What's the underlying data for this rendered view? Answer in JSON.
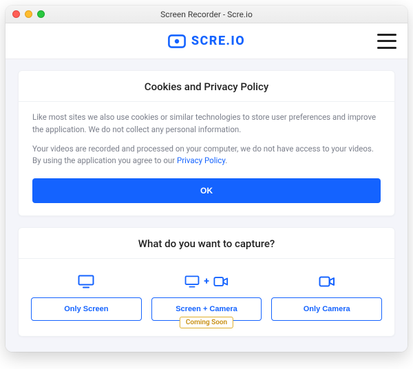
{
  "window": {
    "title": "Screen Recorder - Scre.io"
  },
  "brand": {
    "name": "SCRE.IO",
    "accent": "#1463ff"
  },
  "cookies": {
    "heading": "Cookies and Privacy Policy",
    "p1": "Like most sites we also use cookies or similar technologies to store user preferences and improve the application. We do not collect any personal information.",
    "p2a": "Your videos are recorded and processed on your computer, we do not have access to your videos. By using the application you agree to our ",
    "link_label": "Privacy Policy",
    "p2b": ".",
    "ok_label": "OK"
  },
  "capture": {
    "heading": "What do you want to capture?",
    "options": {
      "screen": {
        "label": "Only Screen"
      },
      "both": {
        "label": "Screen + Camera",
        "badge": "Coming Soon"
      },
      "camera": {
        "label": "Only Camera"
      }
    }
  }
}
